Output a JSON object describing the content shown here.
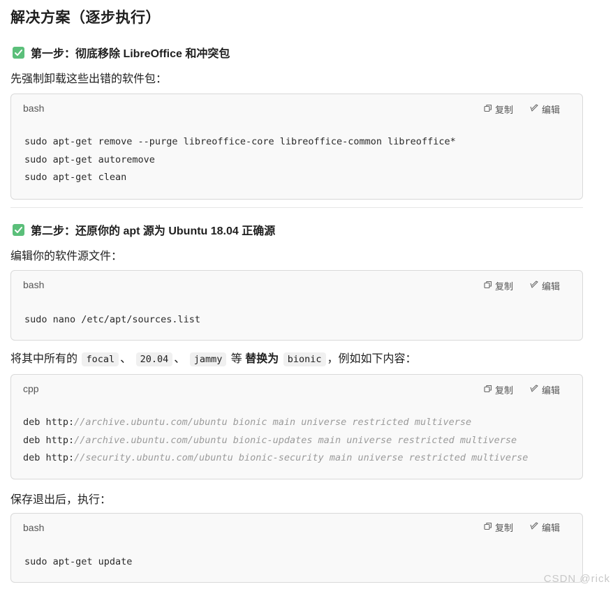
{
  "title": "解决方案（逐步执行）",
  "steps": [
    {
      "heading": "第一步：彻底移除 LibreOffice 和冲突包",
      "intro": "先强制卸载这些出错的软件包："
    },
    {
      "heading": "第二步：还原你的 apt 源为 Ubuntu 18.04 正确源",
      "intro": "编辑你的软件源文件："
    }
  ],
  "replace_sentence": {
    "prefix": "将其中所有的",
    "code1": "focal",
    "sep1": "、",
    "code2": "20.04",
    "sep2": "、",
    "code3": "jammy",
    "middle": "等",
    "bold": "替换为",
    "code4": "bionic",
    "suffix": "，例如如下内容："
  },
  "save_sentence": "保存退出后，执行：",
  "code_actions": {
    "copy": "复制",
    "edit": "编辑"
  },
  "code_blocks": [
    {
      "lang": "bash",
      "lines": [
        "sudo apt-get remove --purge libreoffice-core libreoffice-common libreoffice*",
        "sudo apt-get autoremove",
        "sudo apt-get clean"
      ]
    },
    {
      "lang": "bash",
      "lines": [
        "sudo nano /etc/apt/sources.list"
      ]
    },
    {
      "lang": "cpp",
      "lines": [
        {
          "code": "deb http:",
          "comment": "//archive.ubuntu.com/ubuntu bionic main universe restricted multiverse"
        },
        {
          "code": "deb http:",
          "comment": "//archive.ubuntu.com/ubuntu bionic-updates main universe restricted multiverse"
        },
        {
          "code": "deb http:",
          "comment": "//security.ubuntu.com/ubuntu bionic-security main universe restricted multiverse"
        }
      ]
    },
    {
      "lang": "bash",
      "lines": [
        "sudo apt-get update"
      ]
    }
  ],
  "watermark": "CSDN @rick",
  "icons": {
    "check": "check-icon",
    "copy": "copy-icon",
    "edit": "edit-icon"
  },
  "colors": {
    "check_bg": "#5bbf7a",
    "code_bg": "#f9f9f9",
    "comment": "#9a9a9a"
  }
}
